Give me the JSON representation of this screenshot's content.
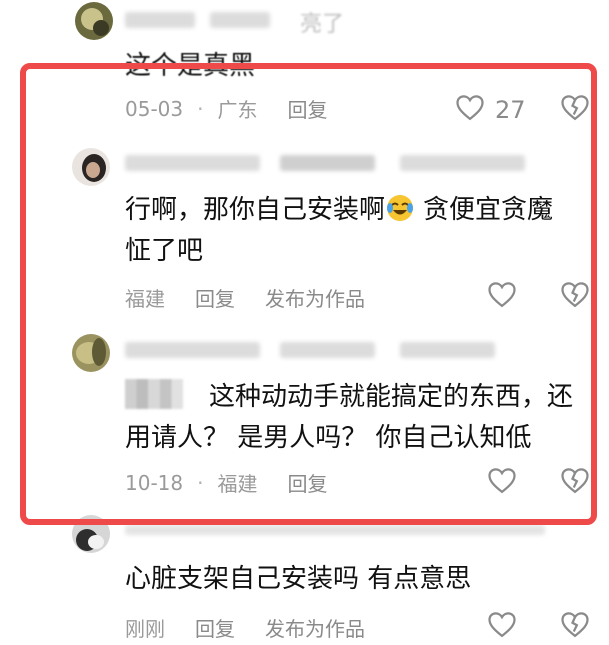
{
  "comments": [
    {
      "name_visible_fragment": "亮了",
      "text": "这个是真黑",
      "date": "05-03",
      "location": "广东",
      "reply_label": "回复",
      "like_count": "27"
    },
    {
      "text_line1": "行啊，那你自己安装啊",
      "text_line1_after_emoji": "贪便宜贪魔",
      "text_line2": "怔了吧",
      "location": "福建",
      "reply_label": "回复",
      "publish_label": "发布为作品"
    },
    {
      "text_line1": "这种动动手就能搞定的东西，还",
      "text_line2": "用请人？ 是男人吗？ 你自己认知低",
      "date": "10-18",
      "location": "福建",
      "reply_label": "回复"
    },
    {
      "text": "心脏支架自己安装吗 有点意思",
      "time": "刚刚",
      "reply_label": "回复",
      "publish_label": "发布为作品"
    }
  ],
  "colors": {
    "highlight_border": "#ef4a4a",
    "meta_text": "#9a9a9a",
    "body_text": "#111111"
  },
  "icons": {
    "like": "heart-outline-icon",
    "dislike": "broken-heart-icon",
    "emoji": "laughing-crying-emoji"
  }
}
